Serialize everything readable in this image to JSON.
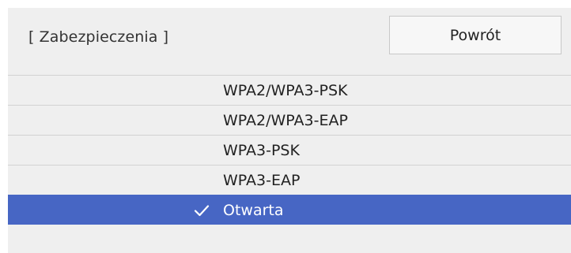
{
  "header": {
    "title": "[ Zabezpieczenia ]",
    "back_label": "Powrót"
  },
  "options": [
    {
      "label": "WPA2/WPA3-PSK",
      "selected": false
    },
    {
      "label": "WPA2/WPA3-EAP",
      "selected": false
    },
    {
      "label": "WPA3-PSK",
      "selected": false
    },
    {
      "label": "WPA3-EAP",
      "selected": false
    },
    {
      "label": "Otwarta",
      "selected": true
    }
  ],
  "colors": {
    "background": "#efefef",
    "selected": "#4766c4",
    "divider": "#d2d2d2"
  },
  "icons": {
    "selected_marker": "check-icon"
  }
}
